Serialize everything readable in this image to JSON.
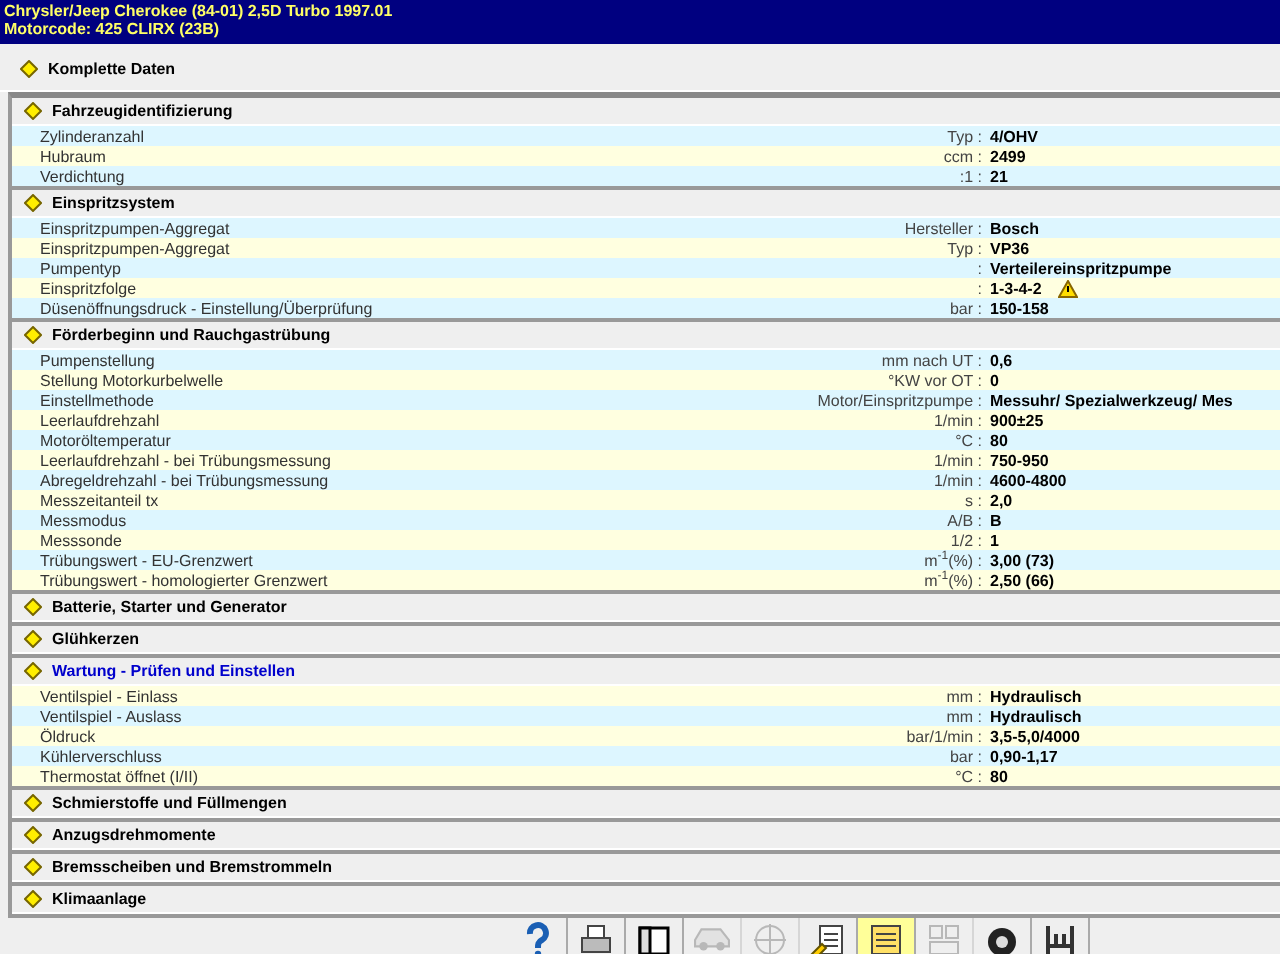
{
  "title_bar": {
    "vehicle": "Chrysler/Jeep   Cherokee (84-01) 2,5D Turbo 1997.01",
    "engine": "Motorcode: 425 CLIRX (23B)"
  },
  "top_link": "Komplette Daten",
  "sections": [
    {
      "title": "Fahrzeugidentifizierung",
      "highlighted": false,
      "rows": [
        {
          "label": "Zylinderanzahl",
          "unit": "Typ :",
          "value": "4/OHV",
          "warning": false
        },
        {
          "label": "Hubraum",
          "unit": "ccm :",
          "value": "2499",
          "warning": false
        },
        {
          "label": "Verdichtung",
          "unit": ":1 :",
          "value": "21",
          "warning": false
        }
      ]
    },
    {
      "title": "Einspritzsystem",
      "highlighted": false,
      "rows": [
        {
          "label": "Einspritzpumpen-Aggregat",
          "unit": "Hersteller :",
          "value": "Bosch",
          "warning": false
        },
        {
          "label": "Einspritzpumpen-Aggregat",
          "unit": "Typ :",
          "value": "VP36",
          "warning": false
        },
        {
          "label": "Pumpentyp",
          "unit": ":",
          "value": "Verteilereinspritzpumpe",
          "warning": false
        },
        {
          "label": "Einspritzfolge",
          "unit": ":",
          "value": "1-3-4-2",
          "warning": true
        },
        {
          "label": "Düsenöffnungsdruck - Einstellung/Überprüfung",
          "unit": "bar :",
          "value": "150-158",
          "warning": false
        }
      ]
    },
    {
      "title": "Förderbeginn und Rauchgastrübung",
      "highlighted": false,
      "rows": [
        {
          "label": "Pumpenstellung",
          "unit": "mm nach UT :",
          "value": "0,6",
          "warning": false
        },
        {
          "label": "Stellung Motorkurbelwelle",
          "unit": "°KW vor OT :",
          "value": "0",
          "warning": false
        },
        {
          "label": "Einstellmethode",
          "unit": "Motor/Einspritzpumpe :",
          "value": "Messuhr/ Spezialwerkzeug/ Mes",
          "warning": false
        },
        {
          "label": "Leerlaufdrehzahl",
          "unit": "1/min :",
          "value": "900±25",
          "warning": false
        },
        {
          "label": "Motoröltemperatur",
          "unit": "°C :",
          "value": "80",
          "warning": false
        },
        {
          "label": "Leerlaufdrehzahl - bei Trübungsmessung",
          "unit": "1/min :",
          "value": "750-950",
          "warning": false
        },
        {
          "label": "Abregeldrehzahl - bei Trübungsmessung",
          "unit": "1/min :",
          "value": "4600-4800",
          "warning": false
        },
        {
          "label": "Messzeitanteil tx",
          "unit": "s :",
          "value": "2,0",
          "warning": false
        },
        {
          "label": "Messmodus",
          "unit": "A/B :",
          "value": "B",
          "warning": false
        },
        {
          "label": "Messsonde",
          "unit": "1/2 :",
          "value": "1",
          "warning": false
        },
        {
          "label": "Trübungswert - EU-Grenzwert",
          "unit": "m$^{-1}$(%) :",
          "value": "3,00 (73)",
          "warning": false
        },
        {
          "label": "Trübungswert - homologierter Grenzwert",
          "unit": "m$^{-1}$(%) :",
          "value": "2,50 (66)",
          "warning": false
        }
      ]
    },
    {
      "title": "Batterie, Starter und Generator",
      "highlighted": false
    },
    {
      "title": "Glühkerzen",
      "highlighted": false
    },
    {
      "title": "Wartung - Prüfen und Einstellen",
      "highlighted": true,
      "rows": [
        {
          "label": "Ventilspiel - Einlass",
          "unit": "mm :",
          "value": "Hydraulisch",
          "warning": false
        },
        {
          "label": "Ventilspiel - Auslass",
          "unit": "mm :",
          "value": "Hydraulisch",
          "warning": false
        },
        {
          "label": "Öldruck",
          "unit": "bar/1/min :",
          "value": "3,5-5,0/4000",
          "warning": false
        },
        {
          "label": "Kühlerverschluss",
          "unit": "bar :",
          "value": "0,90-1,17",
          "warning": false
        },
        {
          "label": "Thermostat öffnet (I/II)",
          "unit": "°C :",
          "value": "80",
          "warning": false
        }
      ]
    },
    {
      "title": "Schmierstoffe und Füllmengen",
      "highlighted": false
    },
    {
      "title": "Anzugsdrehmomente",
      "highlighted": false
    },
    {
      "title": "Bremsscheiben und Bremstrommeln",
      "highlighted": false
    },
    {
      "title": "Klimaanlage",
      "highlighted": false
    }
  ],
  "toolbar": [
    {
      "kind": "help",
      "disabled": false
    },
    {
      "kind": "printer",
      "disabled": false
    },
    {
      "kind": "window",
      "disabled": false
    },
    {
      "kind": "car",
      "disabled": true
    },
    {
      "kind": "wheel",
      "disabled": true
    },
    {
      "kind": "document",
      "disabled": false
    },
    {
      "kind": "chart",
      "disabled": false
    },
    {
      "kind": "grid",
      "disabled": true
    },
    {
      "kind": "tyre",
      "disabled": false
    },
    {
      "kind": "lift",
      "disabled": false
    }
  ]
}
